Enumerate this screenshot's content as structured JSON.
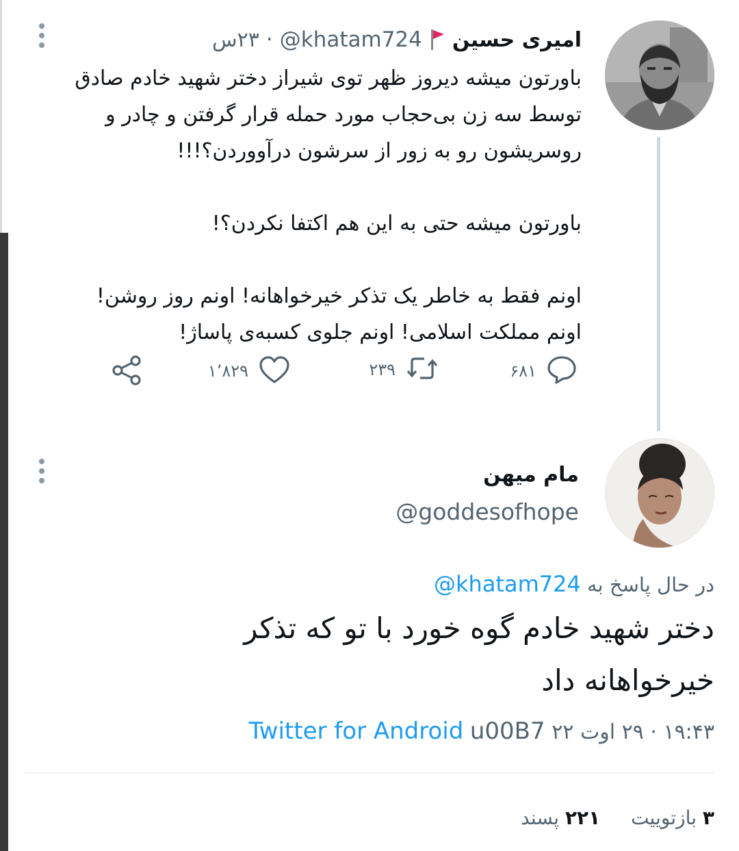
{
  "tweet": {
    "author_name": "امیری حسین",
    "handle": "@khatam724",
    "separator": "·",
    "time": "۲۳س",
    "lines": [
      "باورتون میشه دیروز ظهر توی شیراز دختر شهید خادم صادق",
      "توسط سه زن بی‌حجاب مورد حمله قرار گرفتن و چادر و",
      "روسریشون رو به زور از سرشون درآووردن؟!!!",
      "",
      "باورتون میشه حتی به این هم اکتفا نکردن؟!",
      "",
      "اونم فقط به خاطر یک تذکر خیرخواهانه! اونم روز روشن!",
      "اونم مملکت اسلامی! اونم جلوی کسبه‌ی پاساژ!"
    ],
    "replies": "۶۸۱",
    "retweets": "۲۳۹",
    "likes": "۱٬۸۲۹"
  },
  "reply": {
    "author_name": "مام میهن",
    "handle": "@goddesofhope",
    "replying_prefix": "در حال پاسخ به",
    "replying_to": "@khatam724",
    "lines": [
      "دختر شهید خادم گوه خورد با تو که تذکر",
      "خیرخواهانه داد"
    ],
    "time": "۱۹:۴۳",
    "separator": "·",
    "date": "۲۹ اوت ۲۲",
    "code": "u00B7",
    "source": "Twitter for Android"
  },
  "stats": {
    "retweets_count": "۳",
    "retweets_label": "بازتوییت",
    "likes_count": "۲۲۱",
    "likes_label": "پسند"
  },
  "colors": {
    "accent": "#1d9bf0",
    "muted": "#536471",
    "text": "#0f1419",
    "flag": "#e0245e"
  }
}
